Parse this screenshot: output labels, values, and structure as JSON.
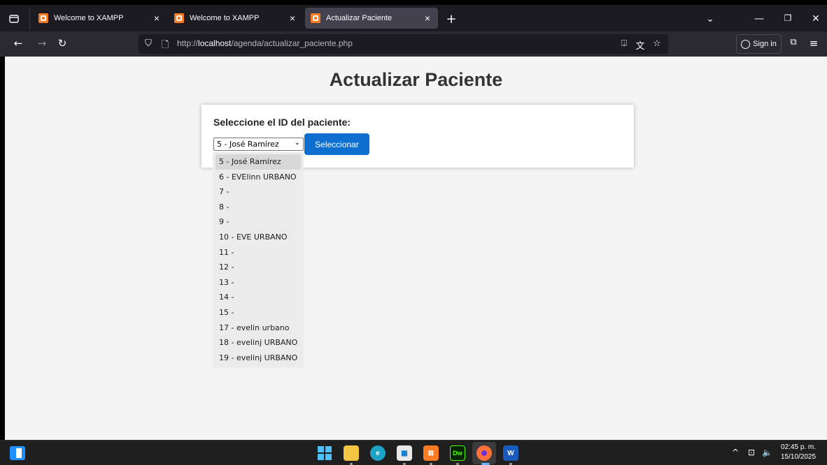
{
  "browser": {
    "tabs": [
      {
        "title": "Welcome to XAMPP",
        "active": false
      },
      {
        "title": "Welcome to XAMPP",
        "active": false
      },
      {
        "title": "Actualizar Paciente",
        "active": true
      }
    ],
    "url_prefix": "http://",
    "url_host": "localhost",
    "url_path": "/agenda/actualizar_paciente.php",
    "signin_label": "Sign in"
  },
  "page": {
    "title": "Actualizar Paciente",
    "select_label": "Seleccione el ID del paciente:",
    "selected_value": "5 - José Ramírez",
    "button_label": "Seleccionar",
    "options": [
      "5 - José Ramírez",
      "6 - EVElinn URBANO",
      "7 -",
      "8 -",
      "9 -",
      "10 - EVE URBANO",
      "11 -",
      "12 -",
      "13 -",
      "14 -",
      "15 -",
      "17 - evelin urbano",
      "18 - evelinj URBANO",
      "19 - evelinj URBANO"
    ]
  },
  "taskbar": {
    "time": "02:45 p. m.",
    "date": "15/10/2025",
    "icons": [
      "windows-start",
      "file-explorer",
      "edge",
      "store",
      "xampp",
      "dreamweaver",
      "firefox",
      "word"
    ]
  },
  "colors": {
    "accent_button": "#0d6fcf",
    "page_background": "#f4f4f4",
    "xampp_orange": "#fb7a24"
  }
}
